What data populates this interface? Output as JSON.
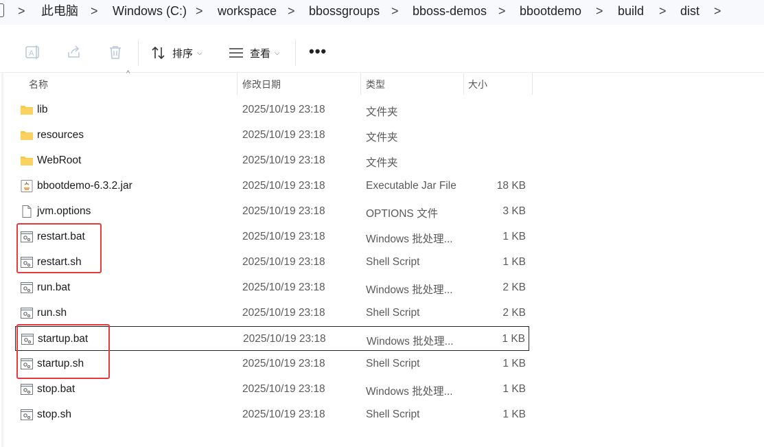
{
  "breadcrumb": {
    "items": [
      "此电脑",
      "Windows (C:)",
      "workspace",
      "bbossgroups",
      "bboss-demos",
      "bbootdemo",
      "build",
      "dist"
    ],
    "separator": ">"
  },
  "toolbar": {
    "sort_label": "排序",
    "view_label": "查看",
    "more_label": "•••"
  },
  "columns": {
    "name": "名称",
    "date": "修改日期",
    "type": "类型",
    "size": "大小"
  },
  "files": [
    {
      "name": "lib",
      "date": "2025/10/19 23:18",
      "type": "文件夹",
      "size": "",
      "icon": "folder-icon"
    },
    {
      "name": "resources",
      "date": "2025/10/19 23:18",
      "type": "文件夹",
      "size": "",
      "icon": "folder-icon"
    },
    {
      "name": "WebRoot",
      "date": "2025/10/19 23:18",
      "type": "文件夹",
      "size": "",
      "icon": "folder-icon"
    },
    {
      "name": "bbootdemo-6.3.2.jar",
      "date": "2025/10/19 23:18",
      "type": "Executable Jar File",
      "size": "18 KB",
      "icon": "jar-icon"
    },
    {
      "name": "jvm.options",
      "date": "2025/10/19 23:18",
      "type": "OPTIONS 文件",
      "size": "3 KB",
      "icon": "file-icon"
    },
    {
      "name": "restart.bat",
      "date": "2025/10/19 23:18",
      "type": "Windows 批处理...",
      "size": "1 KB",
      "icon": "script-icon"
    },
    {
      "name": "restart.sh",
      "date": "2025/10/19 23:18",
      "type": "Shell Script",
      "size": "1 KB",
      "icon": "script-icon"
    },
    {
      "name": "run.bat",
      "date": "2025/10/19 23:18",
      "type": "Windows 批处理...",
      "size": "2 KB",
      "icon": "script-icon"
    },
    {
      "name": "run.sh",
      "date": "2025/10/19 23:18",
      "type": "Shell Script",
      "size": "2 KB",
      "icon": "script-icon"
    },
    {
      "name": "startup.bat",
      "date": "2025/10/19 23:18",
      "type": "Windows 批处理...",
      "size": "1 KB",
      "icon": "script-icon"
    },
    {
      "name": "startup.sh",
      "date": "2025/10/19 23:18",
      "type": "Shell Script",
      "size": "1 KB",
      "icon": "script-icon"
    },
    {
      "name": "stop.bat",
      "date": "2025/10/19 23:18",
      "type": "Windows 批处理...",
      "size": "1 KB",
      "icon": "script-icon"
    },
    {
      "name": "stop.sh",
      "date": "2025/10/19 23:18",
      "type": "Shell Script",
      "size": "1 KB",
      "icon": "script-icon"
    }
  ],
  "focused_index": 9,
  "highlight_color": "#e5393c"
}
